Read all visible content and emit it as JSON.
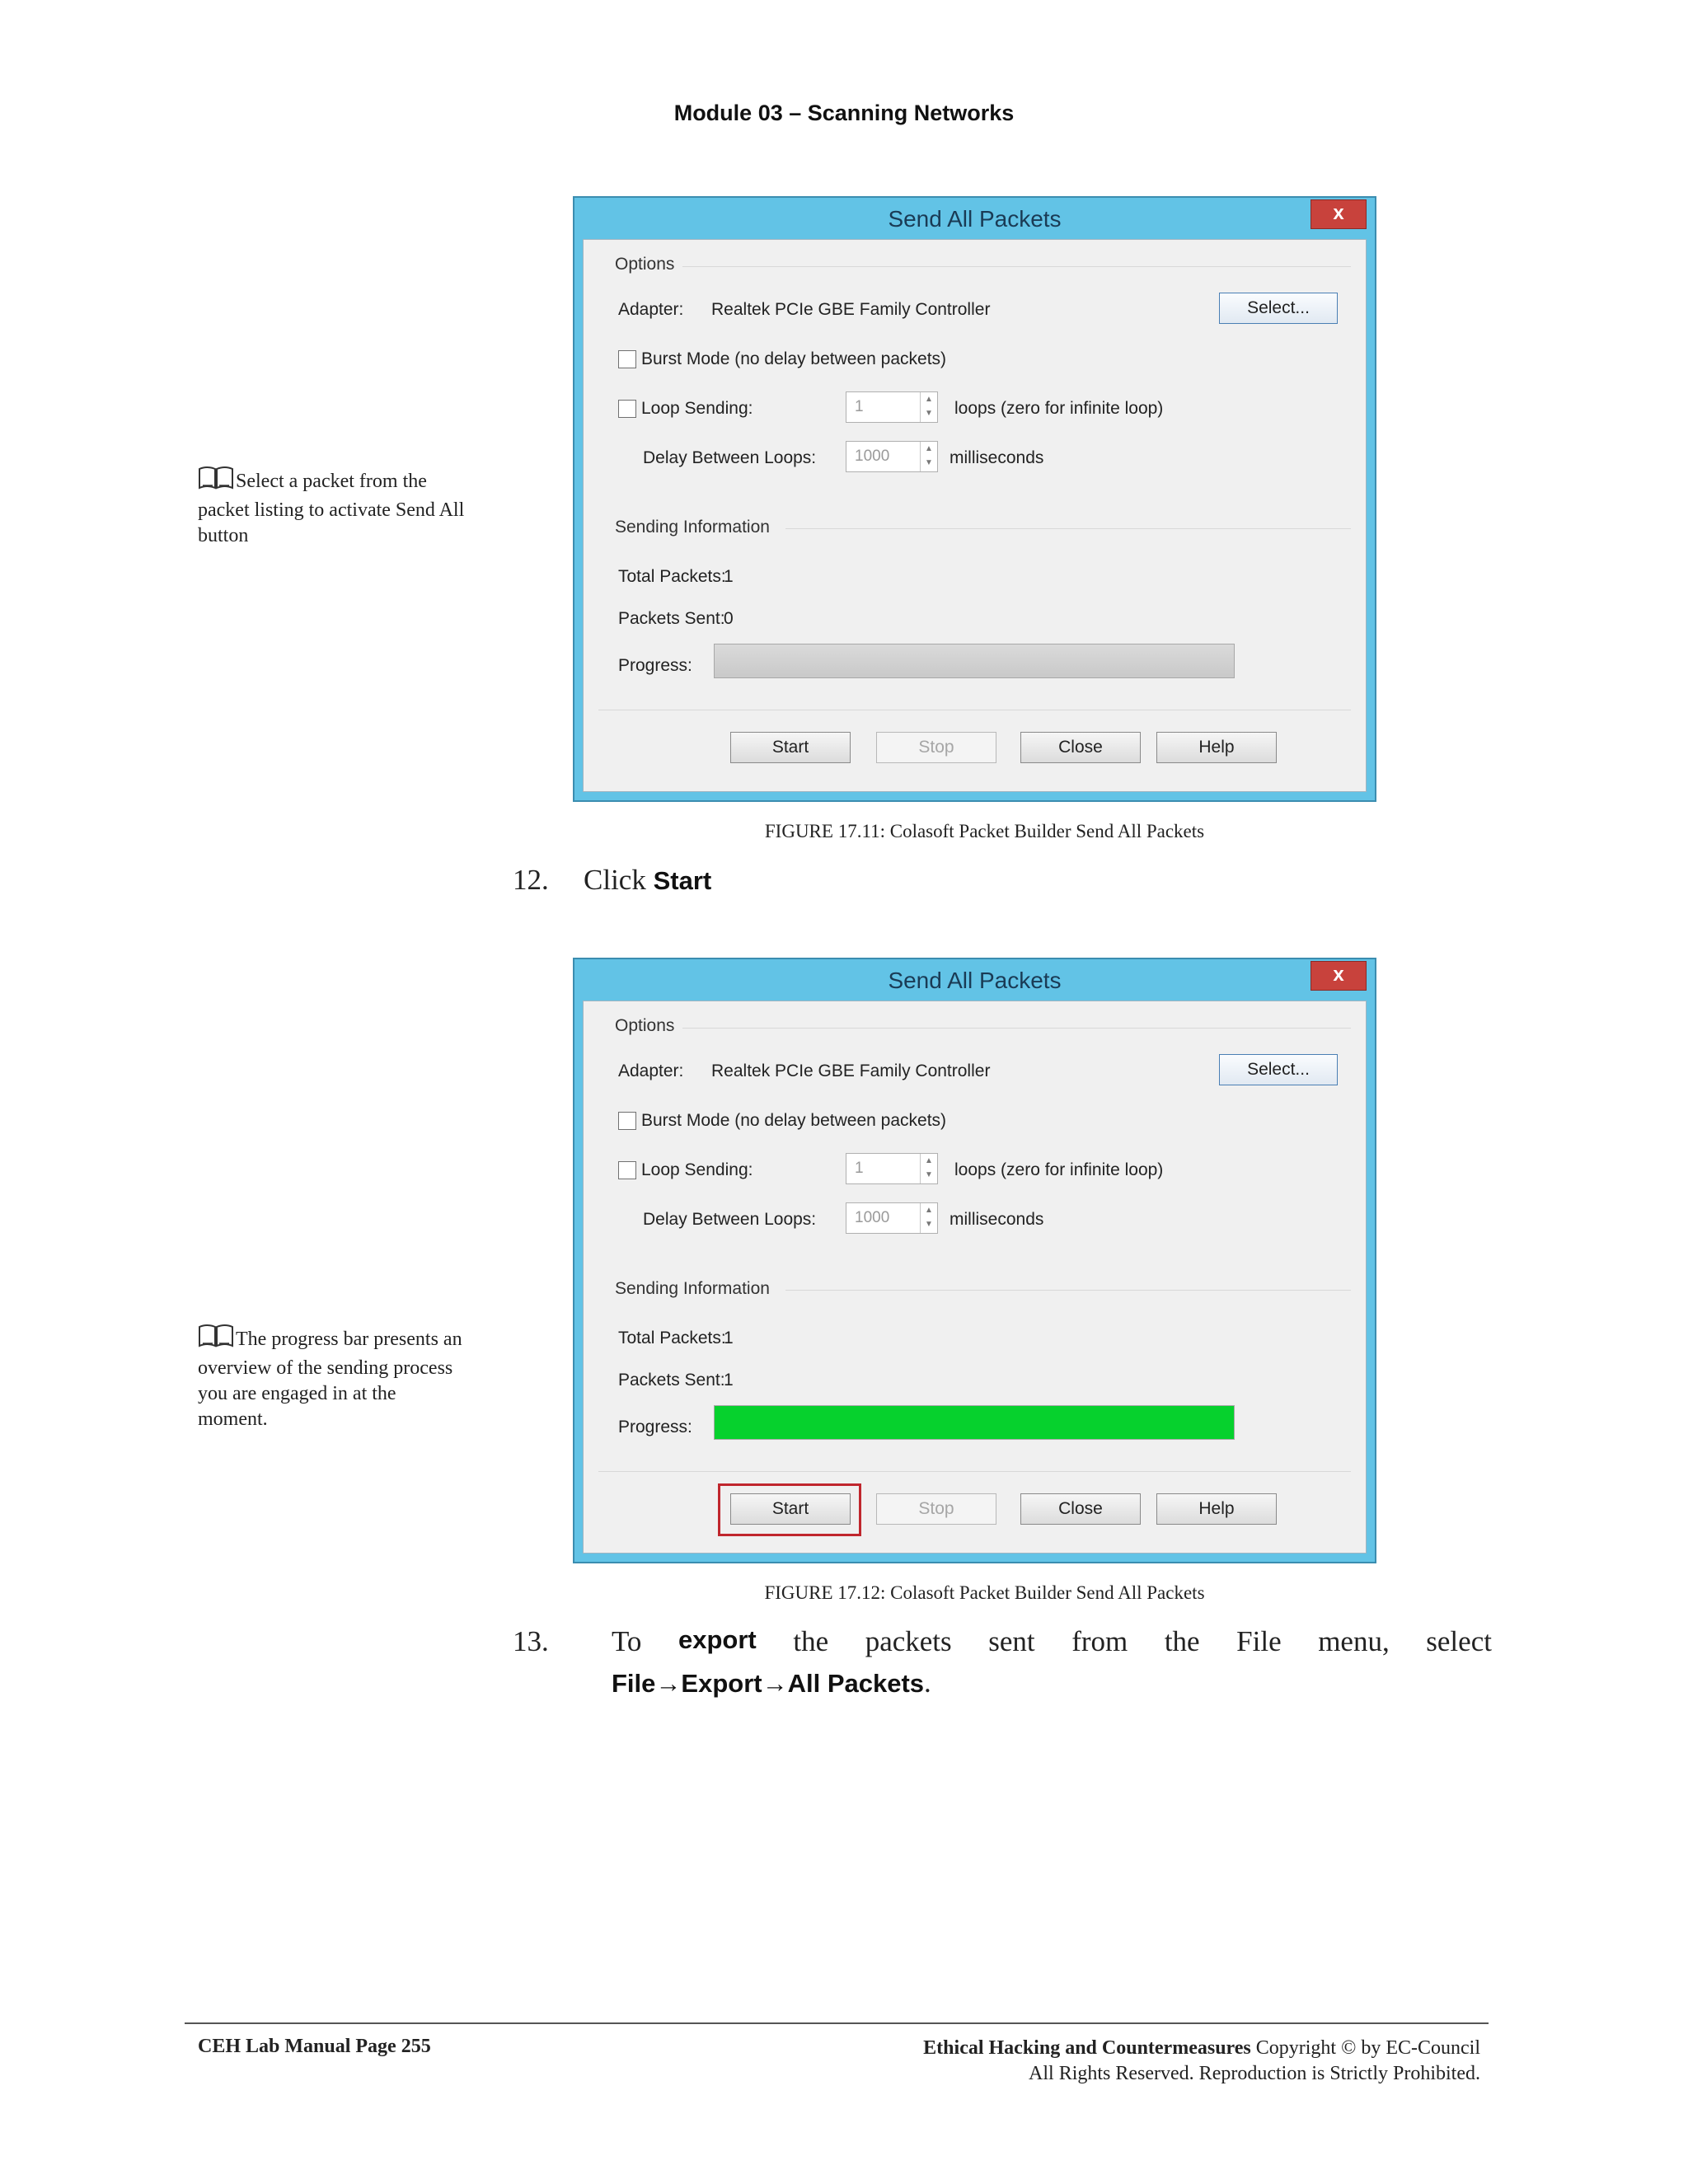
{
  "header": "Module 03 – Scanning Networks",
  "sidenotes": [
    {
      "icon": "book-icon",
      "text": "Select a packet from the packet listing to activate Send All button"
    },
    {
      "icon": "book-icon",
      "text": "The progress bar presents an overview of the sending process you are engaged in at the moment."
    }
  ],
  "dialogs": [
    {
      "title": "Send All Packets",
      "close_label": "x",
      "options_label": "Options",
      "adapter_label": "Adapter:",
      "adapter_value": "Realtek PCIe GBE Family Controller",
      "select_label": "Select...",
      "burst_label": "Burst Mode (no delay between packets)",
      "loop_label": "Loop Sending:",
      "loop_value": "1",
      "loop_suffix": "loops (zero for infinite loop)",
      "delay_label": "Delay Between Loops:",
      "delay_value": "1000",
      "delay_suffix": "milliseconds",
      "sending_label": "Sending Information",
      "total_label": "Total Packets:",
      "total_value": "1",
      "sent_label": "Packets Sent:",
      "sent_value": "0",
      "progress_label": "Progress:",
      "progress": 0,
      "buttons": {
        "start": "Start",
        "stop": "Stop",
        "close": "Close",
        "help": "Help"
      }
    },
    {
      "title": "Send All Packets",
      "close_label": "x",
      "options_label": "Options",
      "adapter_label": "Adapter:",
      "adapter_value": "Realtek PCIe GBE Family Controller",
      "select_label": "Select...",
      "burst_label": "Burst Mode (no delay between packets)",
      "loop_label": "Loop Sending:",
      "loop_value": "1",
      "loop_suffix": "loops (zero for infinite loop)",
      "delay_label": "Delay Between Loops:",
      "delay_value": "1000",
      "delay_suffix": "milliseconds",
      "sending_label": "Sending Information",
      "total_label": "Total Packets:",
      "total_value": "1",
      "sent_label": "Packets Sent:",
      "sent_value": "1",
      "progress_label": "Progress:",
      "progress": 1,
      "highlight_color": "#c0262d",
      "buttons": {
        "start": "Start",
        "stop": "Stop",
        "close": "Close",
        "help": "Help"
      }
    }
  ],
  "captions": [
    "FIGURE 17.11: Colasoft Packet Builder Send All Packets",
    "FIGURE 17.12: Colasoft Packet Builder Send All Packets"
  ],
  "steps": [
    {
      "num": "12.",
      "pre": "Click",
      "bold": "Start"
    },
    {
      "num": "13.",
      "w1": "To",
      "w2": "export",
      "w3": "the",
      "w4": "packets",
      "w5": "sent",
      "w6": "from",
      "w7": "the",
      "w8": "File",
      "w9": "menu,",
      "w10": "select",
      "b1": "File",
      "arrow": "→",
      "b2": "Export",
      "b3": "All Packets",
      "end": "."
    }
  ],
  "footer": {
    "left": "CEH Lab Manual Page 255",
    "right_bold": "Ethical Hacking and Countermeasures",
    "right_rest": " Copyright © by EC-Council",
    "right_line2": "All Rights Reserved. Reproduction is Strictly Prohibited."
  },
  "colors": {
    "progress_fill": "#06d12d",
    "titlebar": "#62c3e6",
    "close_button": "#c8423c"
  }
}
